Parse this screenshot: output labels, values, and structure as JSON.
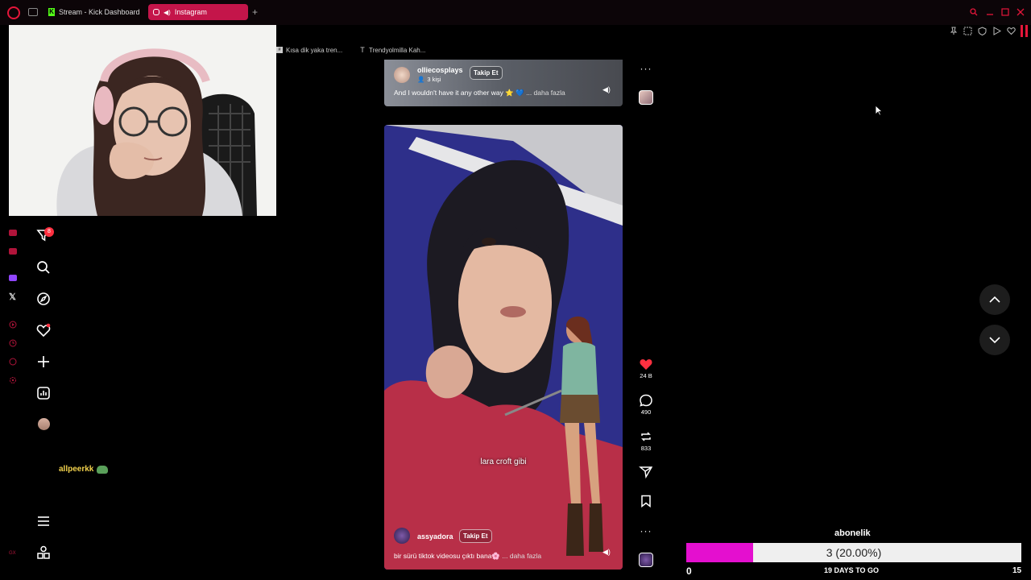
{
  "browser": {
    "tabs": [
      {
        "label": "Stream - Kick Dashboard",
        "icon": "kick-icon"
      },
      {
        "label": "Instagram",
        "icon": "instagram-icon",
        "active": true
      }
    ],
    "bookmarks": [
      {
        "label": "Kısa dik yaka tren...",
        "icon": "bookmark-icon"
      },
      {
        "label": "Trendyolmilla Kah...",
        "icon": "trendyol-icon"
      }
    ],
    "accent_color": "#e4163a"
  },
  "instagram": {
    "nav": {
      "notification_count": "8",
      "items": [
        "filter-icon",
        "search-icon",
        "explore-icon",
        "heart-icon",
        "create-icon",
        "insights-icon",
        "avatar",
        "menu-icon",
        "apps-icon"
      ]
    },
    "reels": [
      {
        "username": "olliecosplays",
        "followers": "3 kişi",
        "follow_label": "Takip Et",
        "caption": "And I wouldn't have it any other way ⭐ 💙",
        "more_label": "... daha fazla"
      },
      {
        "username": "assyadora",
        "follow_label": "Takip Et",
        "caption": "bir sürü tiktok videosu çıktı bana🌸",
        "more_label": "... daha fazla",
        "subtitle": "lara croft gibi",
        "likes": "24 B",
        "comments": "490",
        "reposts": "833"
      }
    ]
  },
  "overlay": {
    "username": "allpeerkk",
    "goal": {
      "title": "abonelik",
      "progress_text": "3 (20.00%)",
      "progress_fraction": 0.2,
      "start": "0",
      "end": "15",
      "days_label": "19 DAYS TO GO",
      "fill_color": "#e40fcf"
    }
  }
}
